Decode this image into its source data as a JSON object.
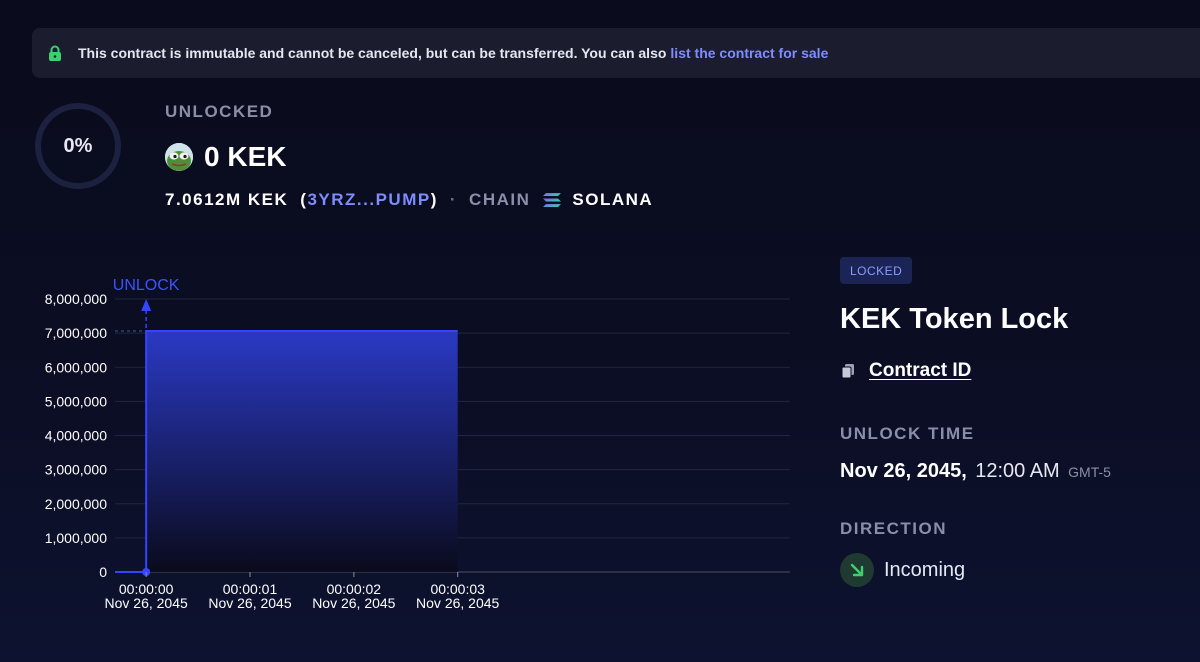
{
  "banner": {
    "lock_icon": "lock-icon",
    "message": "This contract is immutable and cannot be canceled, but can be transferred.  You can also",
    "link_text": "list the contract for sale"
  },
  "progress": {
    "percent_label": "0%",
    "percent_value": 0
  },
  "summary": {
    "unlocked_label": "UNLOCKED",
    "amount": "0 KEK",
    "total": "7.0612M KEK",
    "paren_open": "(",
    "address": "3YRZ...PUMP",
    "paren_close": ")",
    "separator": "·",
    "chain_label": "CHAIN",
    "chain_name": "SOLANA",
    "chain_icon": "solana-icon",
    "token_icon": "pepe-token-avatar"
  },
  "chart_data": {
    "type": "area",
    "annotation": "UNLOCK",
    "x_ticks": [
      {
        "time": "00:00:00",
        "date": "Nov 26, 2045"
      },
      {
        "time": "00:00:01",
        "date": "Nov 26, 2045"
      },
      {
        "time": "00:00:02",
        "date": "Nov 26, 2045"
      },
      {
        "time": "00:00:03",
        "date": "Nov 26, 2045"
      }
    ],
    "y_ticks": [
      "0",
      "1,000,000",
      "2,000,000",
      "3,000,000",
      "4,000,000",
      "5,000,000",
      "6,000,000",
      "7,000,000",
      "8,000,000"
    ],
    "ylim": [
      0,
      8000000
    ],
    "xlim": [
      -0.3,
      6.2
    ],
    "unlock_x": 0,
    "series": [
      {
        "x": [
          -0.3,
          0,
          0,
          3
        ],
        "y": [
          0,
          0,
          7061200,
          7061200
        ]
      }
    ],
    "grid": true,
    "colors": {
      "line": "#3345ff",
      "fill_top": "#2a39c4",
      "fill_bottom": "#0a0b1c",
      "grid": "#23263a"
    }
  },
  "details": {
    "status_badge": "LOCKED",
    "title": "KEK Token Lock",
    "copy_icon": "copy-icon",
    "contract_link": "Contract ID",
    "unlock_time_label": "UNLOCK TIME",
    "unlock_date": "Nov 26, 2045,",
    "unlock_clock": "12:00 AM",
    "unlock_tz": "GMT-5",
    "direction_label": "DIRECTION",
    "direction_icon": "arrow-down-right-icon",
    "direction_value": "Incoming"
  },
  "colors": {
    "accent": "#7f8cff",
    "background": "#0b0d1f",
    "incoming_green": "#3ecf6e"
  }
}
